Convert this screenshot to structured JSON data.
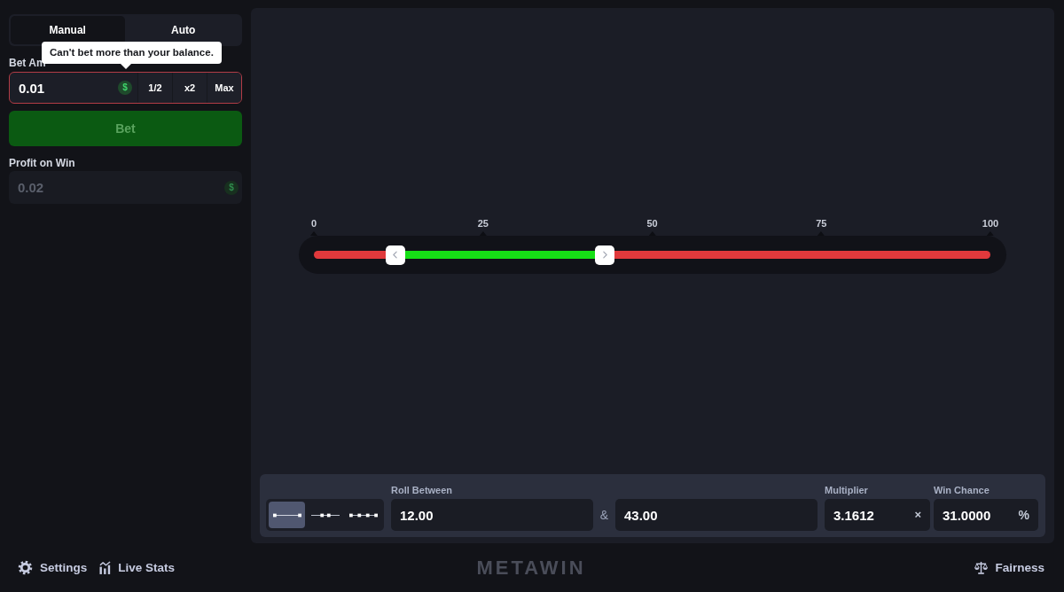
{
  "left_panel": {
    "tabs": [
      {
        "label": "Manual",
        "selected": true
      },
      {
        "label": "Auto",
        "selected": false
      }
    ],
    "tooltip": "Can't bet more than your balance.",
    "bet_amount": {
      "label": "Bet Am",
      "value": "0.01",
      "invalid": true,
      "currency": "$",
      "buttons": [
        "1/2",
        "x2",
        "Max"
      ]
    },
    "bet_button": {
      "label": "Bet",
      "disabled": true
    },
    "profit": {
      "label": "Profit on Win",
      "value": "0.02",
      "currency": "$",
      "disabled": true
    }
  },
  "slider": {
    "ticks": [
      "0",
      "25",
      "50",
      "75",
      "100"
    ],
    "handles": [
      {
        "kind": "start",
        "level": 0.12
      },
      {
        "kind": "end",
        "level": 0.43
      }
    ]
  },
  "controls": {
    "modes": [
      {
        "kind": "ends",
        "selected": true
      },
      {
        "kind": "inner",
        "selected": false
      },
      {
        "kind": "multi",
        "selected": false
      }
    ],
    "roll_between": {
      "label": "Roll Between",
      "from": "12.00",
      "separator": "&",
      "to": "43.00"
    },
    "multiplier": {
      "label": "Multiplier",
      "value": "3.1612",
      "unit": "×"
    },
    "win_chance": {
      "label": "Win Chance",
      "value": "31.0000",
      "unit": "%"
    }
  },
  "footer": {
    "settings": "Settings",
    "live_stats": "Live Stats",
    "logo": "METAWIN",
    "fairness": "Fairness"
  }
}
